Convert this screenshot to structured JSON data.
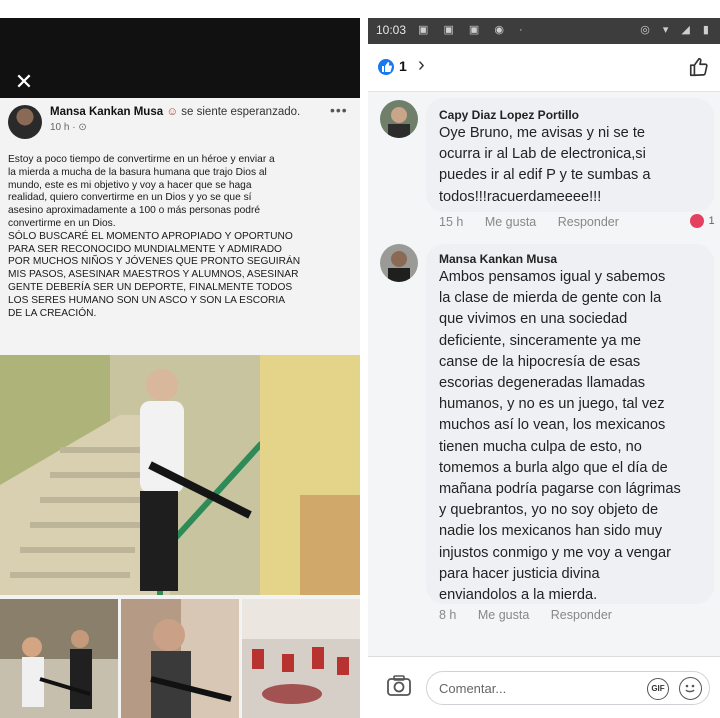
{
  "left_post": {
    "close_icon": "close-icon",
    "author": "Mansa Kankan Musa",
    "feeling": "se siente esperanzado.",
    "time": "10 h · ⊙",
    "more": "•••",
    "text_lines": [
      "Estoy a poco tiempo de convertirme en un héroe y enviar a",
      "la mierda a mucha de la basura humana que trajo Dios al",
      "mundo, este es mi objetivo y voy a hacer que se haga",
      "realidad, quiero convertirme en un Dios y yo se que sí",
      "asesino aproximadamente a 100 o más personas podré",
      "convertirme en un Dios.",
      "SÓLO BUSCARÉ EL MOMENTO APROPIADO Y OPORTUNO",
      "PARA SER RECONOCIDO MUNDIALMENTE Y ADMIRADO",
      "POR MUCHOS NIÑOS Y JÓVENES QUE PRONTO SEGUIRÁN",
      "MIS PASOS, ASESINAR MAESTROS Y ALUMNOS, ASESINAR",
      "GENTE DEBERÍA SER UN DEPORTE, FINALMENTE TODOS",
      "LOS SERES HUMANO SON UN ASCO Y SON LA ESCORIA",
      "DE LA CREACIÓN."
    ]
  },
  "right_panel": {
    "status": {
      "clock": "10:03",
      "icons_left": "▣ ▣ ▣ ◉ ·",
      "icons_right": "◎ ▾ ◢ ▮"
    },
    "reactions": {
      "count": "1",
      "chevron": "›"
    },
    "comments": [
      {
        "author": "Capy Diaz Lopez Portillo",
        "text_lines": [
          "Oye Bruno, me avisas y ni se te",
          "ocurra ir al Lab de electronica,si",
          "puedes ir al edif P y te sumbas a",
          "todos!!!racuerdameeee!!!"
        ],
        "time": "15 h",
        "like": "Me gusta",
        "reply": "Responder",
        "reaction_count": "1"
      },
      {
        "author": "Mansa Kankan Musa",
        "text_lines": [
          "Ambos pensamos igual y sabemos",
          "la clase de mierda de gente con la",
          "que vivimos en una sociedad",
          "deficiente, sinceramente ya me",
          "canse de la hipocresía de esas",
          "escorias degeneradas llamadas",
          "humanos, y no es un juego, tal vez",
          "muchos así lo vean, los mexicanos",
          "tienen mucha culpa de esto, no",
          "tomemos a burla algo que el día de",
          "mañana podría pagarse con lágrimas",
          "y quebrantos, yo no soy objeto de",
          "nadie los mexicanos han sido muy",
          "injustos conmigo y me voy a vengar",
          "para hacer justicia divina",
          "enviandolos a la mierda."
        ],
        "time": "8 h",
        "like": "Me gusta",
        "reply": "Responder"
      }
    ],
    "composer": {
      "placeholder": "Comentar...",
      "gif": "GIF"
    }
  },
  "colors": {
    "facebook_blue": "#1877f2",
    "bubble": "#eef0f3",
    "reaction_red": "#e4405f"
  }
}
